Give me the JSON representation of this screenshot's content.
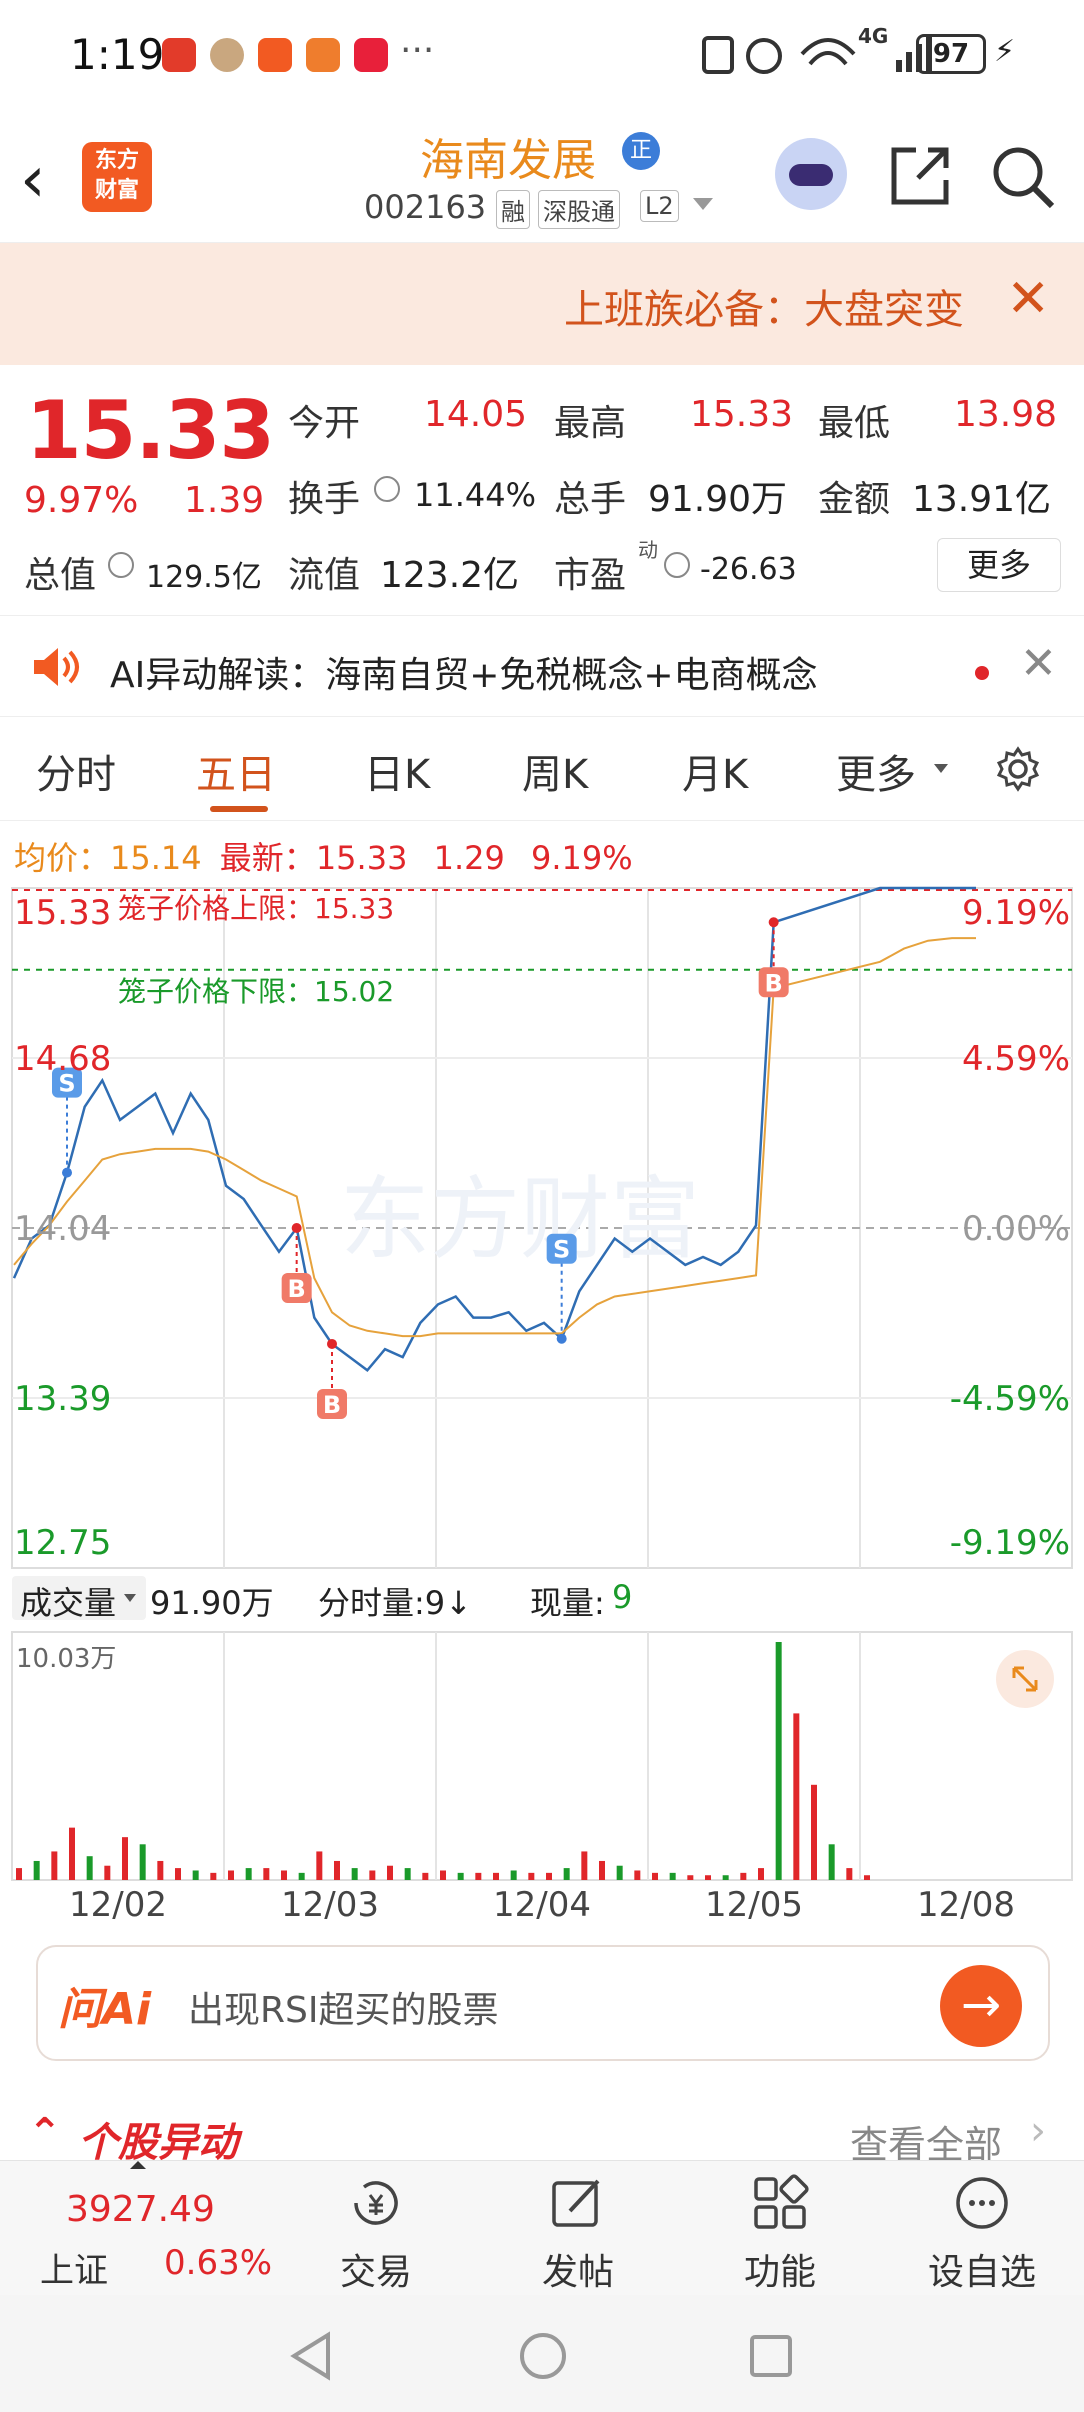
{
  "status_bar": {
    "time": "1:19",
    "signal_label": "4G",
    "battery": "97"
  },
  "header": {
    "logo_text_1": "东方",
    "logo_text_2": "财富",
    "stock_name": "海南发展",
    "badge": "正",
    "code": "002163",
    "tags": [
      "融",
      "深股通",
      "L2"
    ]
  },
  "promo": {
    "text": "上班族必备：大盘突变"
  },
  "quote": {
    "price": "15.33",
    "change_pct": "9.97%",
    "change_amt": "1.39",
    "open_label": "今开",
    "open": "14.05",
    "high_label": "最高",
    "high": "15.33",
    "low_label": "最低",
    "low": "13.98",
    "turnover_label": "换手",
    "turnover": "11.44%",
    "volume_label": "总手",
    "volume": "91.90万",
    "amount_label": "金额",
    "amount": "13.91亿",
    "mktcap_label": "总值",
    "mktcap": "129.5亿",
    "float_label": "流值",
    "float": "123.2亿",
    "pe_label": "市盈",
    "pe_sup": "动",
    "pe": "-26.63",
    "more": "更多"
  },
  "ai_bar": {
    "text": "AI异动解读：海南自贸+免税概念+电商概念"
  },
  "tabs": {
    "items": [
      "分时",
      "五日",
      "日K",
      "周K",
      "月K",
      "更多"
    ],
    "active": "五日"
  },
  "avg_line": {
    "avg_label": "均价：",
    "avg": "15.14",
    "latest_label": "最新：",
    "latest": "15.33",
    "change": "1.29",
    "pct": "9.19%"
  },
  "chart_data": {
    "type": "line",
    "x_labels": [
      "12/02",
      "12/03",
      "12/04",
      "12/05",
      "12/08"
    ],
    "y_left_ticks": [
      "15.33",
      "14.68",
      "14.04",
      "13.39",
      "12.75"
    ],
    "y_right_ticks": [
      "9.19%",
      "4.59%",
      "0.00%",
      "-4.59%",
      "-9.19%"
    ],
    "ylim": [
      12.75,
      15.33
    ],
    "upper_limit_label": "笼子价格上限：15.33",
    "lower_limit_label": "笼子价格下限：15.02",
    "watermark": "东方财富",
    "colors": {
      "price": "#2f6db3",
      "avg": "#e6a23c",
      "up": "#e0262a",
      "down": "#1a9a2a"
    },
    "series": [
      {
        "name": "price",
        "values": [
          13.85,
          14.0,
          14.05,
          14.25,
          14.5,
          14.6,
          14.45,
          14.5,
          14.55,
          14.4,
          14.55,
          14.45,
          14.2,
          14.15,
          14.05,
          13.95,
          14.04,
          13.7,
          13.6,
          13.55,
          13.5,
          13.58,
          13.55,
          13.68,
          13.75,
          13.78,
          13.7,
          13.7,
          13.72,
          13.65,
          13.68,
          13.62,
          13.8,
          13.9,
          14.0,
          13.95,
          14.0,
          13.95,
          13.9,
          13.93,
          13.9,
          13.95,
          14.05,
          15.2,
          15.33,
          15.33,
          15.33,
          15.33,
          15.33
        ]
      },
      {
        "name": "avg",
        "values": [
          13.9,
          13.98,
          14.05,
          14.14,
          14.22,
          14.3,
          14.32,
          14.33,
          14.34,
          14.34,
          14.34,
          14.33,
          14.3,
          14.26,
          14.22,
          14.19,
          14.16,
          13.85,
          13.72,
          13.67,
          13.65,
          13.64,
          13.63,
          13.63,
          13.64,
          13.64,
          13.64,
          13.64,
          13.64,
          13.64,
          13.64,
          13.64,
          13.7,
          13.75,
          13.78,
          13.79,
          13.8,
          13.81,
          13.82,
          13.83,
          13.84,
          13.85,
          13.86,
          14.95,
          15.05,
          15.1,
          15.13,
          15.14,
          15.14
        ]
      }
    ],
    "markers": [
      {
        "label": "S",
        "idx": 3,
        "type": "sell"
      },
      {
        "label": "B",
        "idx": 16,
        "type": "buy"
      },
      {
        "label": "B",
        "idx": 18,
        "type": "buy"
      },
      {
        "label": "S",
        "idx": 31,
        "type": "sell"
      },
      {
        "label": "B",
        "idx": 43,
        "type": "buy"
      }
    ]
  },
  "volume": {
    "label": "成交量",
    "total": "91.90万",
    "unit_label": "分时量:9↓",
    "now_label": "现量:",
    "now": "9",
    "max_label": "10.03万",
    "values": [
      0.05,
      0.08,
      0.12,
      0.22,
      0.1,
      0.06,
      0.18,
      0.15,
      0.08,
      0.05,
      0.04,
      0.03,
      0.04,
      0.05,
      0.05,
      0.04,
      0.03,
      0.12,
      0.08,
      0.05,
      0.04,
      0.06,
      0.05,
      0.03,
      0.04,
      0.03,
      0.03,
      0.03,
      0.04,
      0.03,
      0.03,
      0.05,
      0.12,
      0.08,
      0.06,
      0.04,
      0.03,
      0.03,
      0.02,
      0.02,
      0.02,
      0.03,
      0.05,
      1.0,
      0.7,
      0.4,
      0.15,
      0.05,
      0.02
    ]
  },
  "ai_input": {
    "brand": "问Ai",
    "placeholder": "出现RSI超买的股票"
  },
  "section": {
    "title": "个股异动",
    "view_all": "查看全部"
  },
  "bottom_nav": {
    "index_value": "3927.49",
    "index_name": "上证",
    "index_change": "0.63%",
    "items": [
      "交易",
      "发帖",
      "功能",
      "设自选"
    ]
  }
}
